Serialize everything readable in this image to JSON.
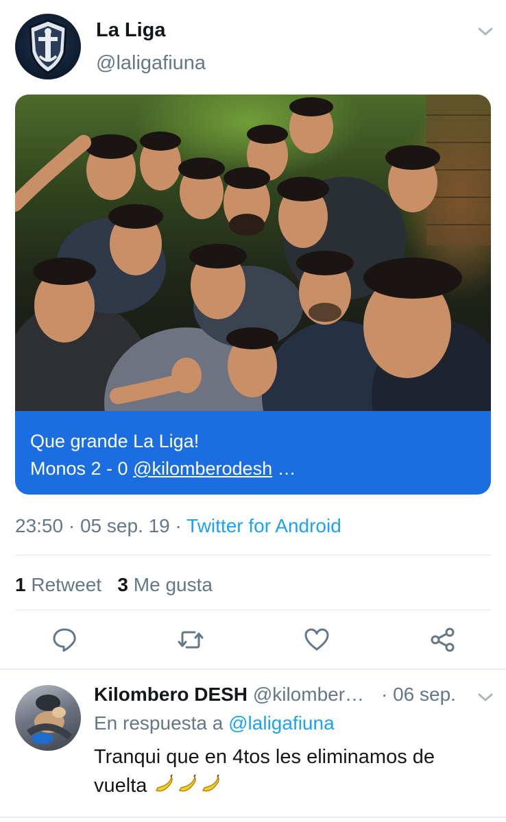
{
  "tweet": {
    "author_name": "La Liga",
    "author_handle": "@laligafiuna",
    "caption_line1": "Que grande La Liga!",
    "caption_line2_prefix": "Monos 2 - 0 ",
    "caption_mention": "@kilomberodesh",
    "caption_ellipsis": " …",
    "time": "23:50",
    "date": "05 sep. 19",
    "separator": " · ",
    "source": "Twitter for Android",
    "retweets_count": "1",
    "retweets_label": "Retweet",
    "likes_count": "3",
    "likes_label": "Me gusta"
  },
  "actions": [
    {
      "name": "reply",
      "icon": "comment-icon"
    },
    {
      "name": "retweet",
      "icon": "retweet-icon"
    },
    {
      "name": "like",
      "icon": "heart-icon"
    },
    {
      "name": "share",
      "icon": "share-icon"
    }
  ],
  "reply": {
    "author_name": "Kilombero DESH",
    "author_handle": "@kilomber…",
    "date": "· 06 sep.",
    "in_reply_prefix": "En respuesta a ",
    "in_reply_mention": "@laligafiuna",
    "text": "Tranqui que en 4tos les eliminamos de vuelta",
    "emoji": "banana-emoji"
  },
  "colors": {
    "link_blue": "#1da1f2",
    "caption_bg": "#1b6de0",
    "secondary_text": "#657786",
    "primary_text": "#14171a"
  }
}
